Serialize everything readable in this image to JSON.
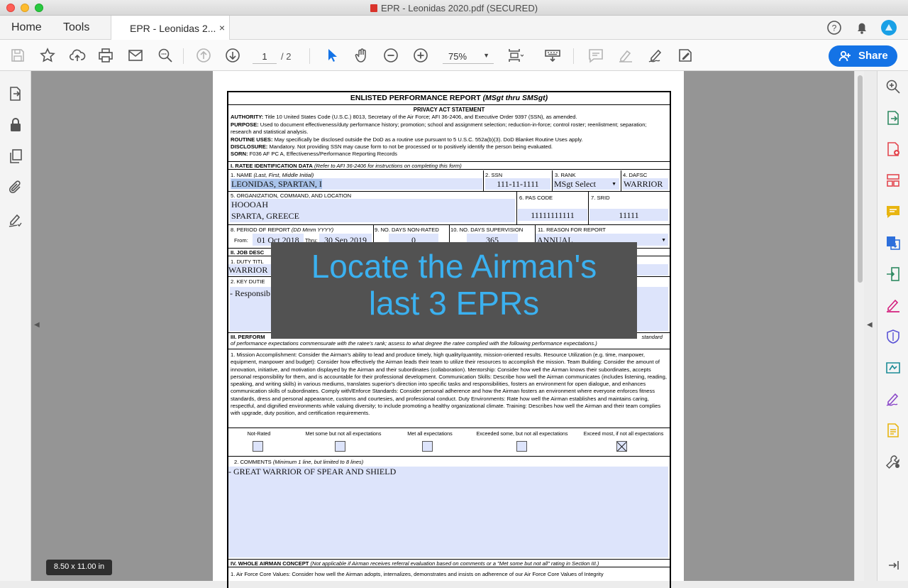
{
  "window": {
    "title": "EPR - Leonidas 2020.pdf (SECURED)"
  },
  "tabs": {
    "home": "Home",
    "tools": "Tools",
    "document": "EPR - Leonidas 2...",
    "close": "×"
  },
  "toolbar": {
    "page_current": "1",
    "page_total": "/ 2",
    "zoom": "75%",
    "share": "Share"
  },
  "form": {
    "title": "ENLISTED PERFORMANCE REPORT",
    "title_italic": "(MSgt thru SMSgt)",
    "privacy_heading": "PRIVACY ACT STATEMENT",
    "authority_label": "AUTHORITY:",
    "authority": " Title 10 United States Code (U.S.C.) 8013, Secretary of the Air Force; AFI 36-2406, and Executive Order 9397 (SSN), as amended.",
    "purpose_label": "PURPOSE:",
    "purpose": " Used to document effectiveness/duty performance history; promotion; school and assignment selection; reduction-in-force; control roster; reenlistment; separation; research and statistical analysis.",
    "routine_label": "ROUTINE USES:",
    "routine": " May specifically be disclosed outside the DoD as a routine use pursuant to 5 U.S.C. 552a(b)(3). DoD Blanket Routine Uses apply.",
    "disclosure_label": "DISCLOSURE:",
    "disclosure": " Mandatory.  Not providing SSN may cause form to not be processed or to positively identify the person being evaluated.",
    "sorn_label": "SORN:",
    "sorn": " F036 AF PC A, Effectiveness/Performance Reporting Records",
    "sec1": "I.  RATEE IDENTIFICATION DATA",
    "sec1_note": "(Refer to AFI 36-2406 for instructions on completing this form)",
    "name_label": "1.  NAME",
    "name_hint": "(Last, First, Middle Initial)",
    "name_value": "LEONIDAS, SPARTAN, I",
    "ssn_label": "2.  SSN",
    "ssn_value": "111-11-1111",
    "rank_label": "3.  RANK",
    "rank_value": "MSgt Select",
    "dafsc_label": "4.  DAFSC",
    "dafsc_value": "WARRIOR",
    "org_label": "5.  ORGANIZATION, COMMAND, AND LOCATION",
    "org_line1": "HOOOAH",
    "org_line2": "SPARTA, GREECE",
    "pas_label": "6.  PAS CODE",
    "pas_value": "11111111111",
    "srid_label": "7.  SRID",
    "srid_value": "11111",
    "period_label": "8. PERIOD OF REPORT",
    "period_hint": "(DD Mmm YYYY)",
    "from_label": "From:",
    "from_value": "01 Oct 2018",
    "thru_label": "Thru:",
    "thru_value": "30 Sep 2019",
    "nonrated_label": "9. NO. DAYS NON-RATED",
    "nonrated_value": "0",
    "supervision_label": "10. NO. DAYS SUPERVISION",
    "supervision_value": "365",
    "reason_label": "11.  REASON FOR REPORT",
    "reason_value": "ANNUAL",
    "sec2": "II.  JOB DESC",
    "duty_title_label": "1.  DUTY TITL",
    "duty_title_value": "WARRIOR",
    "key_duties_label": "2.  KEY DUTIE",
    "key_duties_value": "- Responsib",
    "sec3": "III.  PERFORM",
    "sec3_tail": "standard",
    "sec3_line2": "of performance expectations commensurate with the ratee's rank; assess to what degree the ratee complied with the following performance expectations.)",
    "mission_text": "1.  Mission Accomplishment: Consider the Airman's ability to lead and produce timely, high quality/quantity, mission-oriented results.  Resource Utilization (e.g. time, manpower, equipment, manpower and budget): Consider how effectively the Airman leads their team to utilize their resources to accomplish the mission.  Team Building: Consider the amount of innovation, initiative, and motivation displayed by the Airman and their subordinates (collaboration). Mentorship: Consider how well the Airman knows their subordinates, accepts personal responsibility for them, and is accountable for their professional development.  Communication Skills: Describe how well the Airman communicates (includes listening, reading, speaking, and writing skills) in various mediums, translates superior's direction into specific tasks and responsibilities, fosters an environment for open dialogue, and enhances communication skills of subordinates. Comply with/Enforce Standards: Consider personal adherence and how the Airman fosters an environment where everyone enforces fitness standards, dress and personal appearance, customs and courtesies, and professional conduct.  Duty Environments:  Rate how well the Airman establishes and maintains caring, respectful, and dignified environments while valuing diversity; to include promoting a healthy organizational climate. Training: Describes how well the Airman and their team complies with upgrade, duty position, and certification requirements.",
    "ratings": [
      "Not-Rated",
      "Met some but not all expectations",
      "Met all expectations",
      "Exceeded some, but not all expectations",
      "Exceed most, if not all expectations"
    ],
    "selected_rating": 4,
    "comments_label": "2.  COMMENTS",
    "comments_hint": "(Minimum 1 line, but limited to 8 lines)",
    "comments_value": "- GREAT WARRIOR OF SPEAR AND SHIELD",
    "sec4": "IV.  WHOLE AIRMAN CONCEPT",
    "sec4_note": "(Not applicable if Airman receives referral evaluation based on comments or a \"Met some but not all\" rating in Section III.)",
    "core_values": "1. Air Force Core Values: Consider how well the Airman adopts, internalizes, demonstrates and insists on adherence of our Air Force Core Values of Integrity"
  },
  "overlay": {
    "line1": "Locate the Airman's",
    "line2": "last 3 EPRs",
    "color": "#3bb1f0"
  },
  "page_size": "8.50 x 11.00 in",
  "colors": {
    "accent": "#1473e6",
    "field_fill": "#dde4fb",
    "canvas": "#959595"
  }
}
